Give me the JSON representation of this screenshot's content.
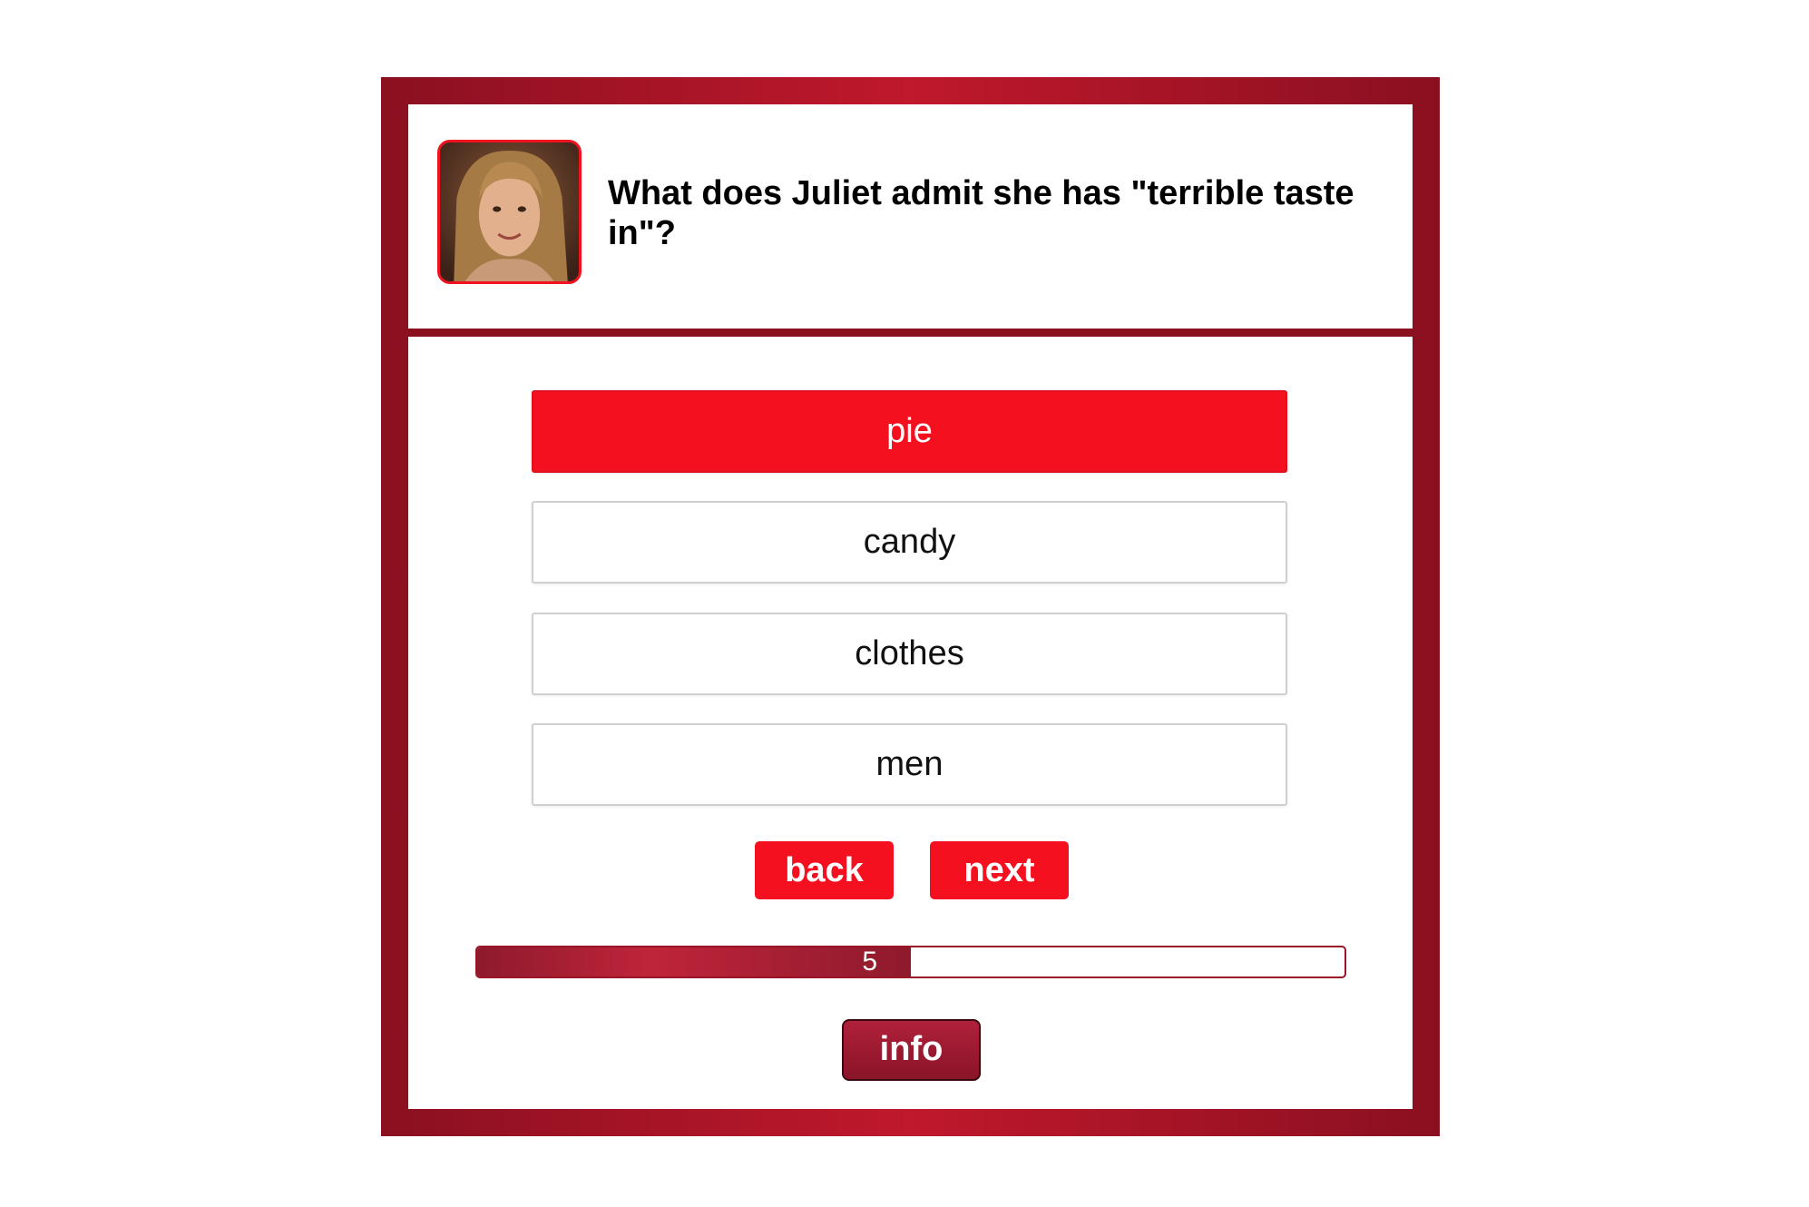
{
  "question": {
    "text": "What does Juliet admit she has \"terrible taste in\"?"
  },
  "answers": [
    {
      "label": "pie",
      "selected": true
    },
    {
      "label": "candy",
      "selected": false
    },
    {
      "label": "clothes",
      "selected": false
    },
    {
      "label": "men",
      "selected": false
    }
  ],
  "navigation": {
    "back_label": "back",
    "next_label": "next"
  },
  "progress": {
    "current": "5",
    "fraction": 0.5
  },
  "info": {
    "label": "info"
  },
  "colors": {
    "accent_red": "#f5101f",
    "frame_dark_red": "#8a1020",
    "frame_light_red": "#c0182c"
  }
}
